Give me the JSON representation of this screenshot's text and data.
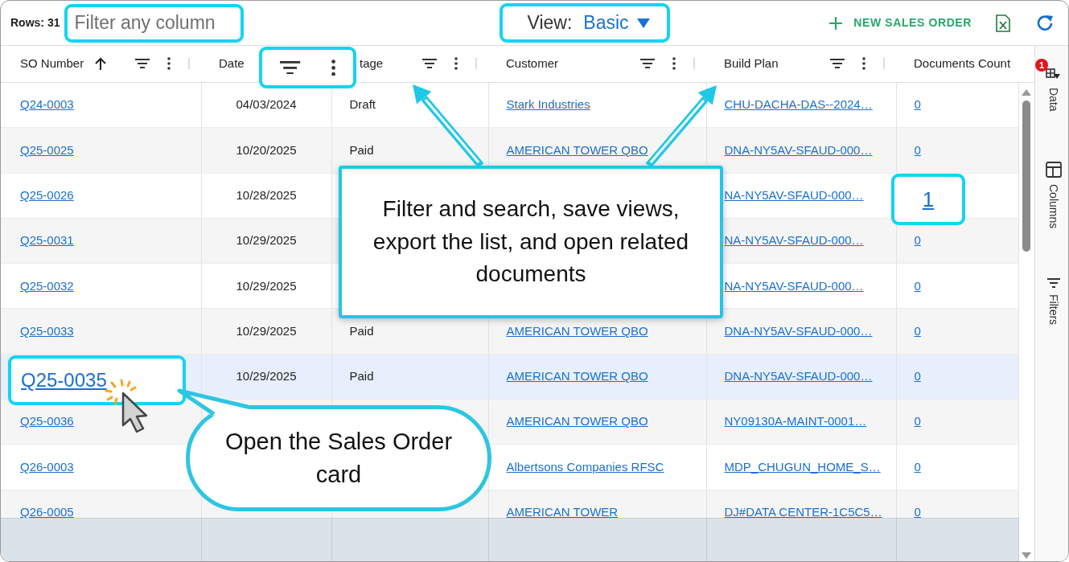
{
  "toolbar": {
    "rows_label": "Rows: 31",
    "filter": {
      "placeholder": "Filter any column"
    },
    "view": {
      "label": "View:",
      "value": "Basic"
    },
    "new_button": "NEW SALES ORDER"
  },
  "columns": [
    {
      "label": "SO Number",
      "kind": "link",
      "sorted": true,
      "has_menu": true,
      "zoomed": false
    },
    {
      "label": "Date",
      "kind": "date",
      "sorted": false,
      "has_menu": true,
      "zoomed": true
    },
    {
      "label": "tage",
      "kind": "text",
      "sorted": false,
      "has_menu": true,
      "zoomed": false
    },
    {
      "label": "Customer",
      "kind": "link",
      "sorted": false,
      "has_menu": true,
      "zoomed": false
    },
    {
      "label": "Build Plan",
      "kind": "link",
      "sorted": false,
      "has_menu": true,
      "zoomed": false
    },
    {
      "label": "Documents Count",
      "kind": "link",
      "sorted": false,
      "has_menu": false,
      "zoomed": false
    }
  ],
  "rows": [
    {
      "so_number": "Q24-0003",
      "date": "04/03/2024",
      "stage": "Draft",
      "customer": "Stark Industries",
      "build_plan": "CHU-DACHA-DAS--2024…",
      "documents": "0",
      "selected": false,
      "number_zoomed": false,
      "count_zoomed": false
    },
    {
      "so_number": "Q25-0025",
      "date": "10/20/2025",
      "stage": "Paid",
      "customer": "AMERICAN TOWER QBO",
      "build_plan": "DNA-NY5AV-SFAUD-000…",
      "documents": "0",
      "selected": false,
      "number_zoomed": false,
      "count_zoomed": false
    },
    {
      "so_number": "Q25-0026",
      "date": "10/28/2025",
      "build_plan": "NA-NY5AV-SFAUD-000…",
      "documents": "1",
      "selected": false,
      "number_zoomed": false,
      "count_zoomed": true
    },
    {
      "so_number": "Q25-0031",
      "date": "10/29/2025",
      "build_plan": "NA-NY5AV-SFAUD-000…",
      "documents": "0",
      "selected": false,
      "number_zoomed": false,
      "count_zoomed": false
    },
    {
      "so_number": "Q25-0032",
      "date": "10/29/2025",
      "build_plan": "NA-NY5AV-SFAUD-000…",
      "documents": "0",
      "selected": false,
      "number_zoomed": false,
      "count_zoomed": false
    },
    {
      "so_number": "Q25-0033",
      "date": "10/29/2025",
      "stage": "Paid",
      "customer": "AMERICAN TOWER QBO",
      "build_plan": "DNA-NY5AV-SFAUD-000…",
      "documents": "0",
      "selected": false,
      "number_zoomed": false,
      "count_zoomed": false
    },
    {
      "so_number": "Q25-0035",
      "date": "10/29/2025",
      "stage": "Paid",
      "customer": "AMERICAN TOWER QBO",
      "build_plan": "DNA-NY5AV-SFAUD-000…",
      "documents": "0",
      "selected": true,
      "number_zoomed": true,
      "count_zoomed": false
    },
    {
      "so_number": "Q25-0036",
      "customer": "AMERICAN TOWER QBO",
      "build_plan": "NY09130A-MAINT-0001…",
      "documents": "0",
      "selected": false,
      "number_zoomed": false,
      "count_zoomed": false
    },
    {
      "so_number": "Q26-0003",
      "customer": "Albertsons Companies RFSC",
      "build_plan": "MDP_CHUGUN_HOME_S…",
      "documents": "0",
      "selected": false,
      "number_zoomed": false,
      "count_zoomed": false
    },
    {
      "so_number": "Q26-0005",
      "customer": "AMERICAN TOWER",
      "build_plan": "DJ#DATA CENTER-1C5C5…",
      "documents": "0",
      "selected": false,
      "number_zoomed": false,
      "count_zoomed": false
    }
  ],
  "side_tabs": [
    {
      "label": "Data",
      "badge": "1"
    },
    {
      "label": "Columns"
    },
    {
      "label": "Filters"
    }
  ],
  "callouts": [
    {
      "kind": "box",
      "text": "Filter and search, save views, export the list, and open related documents"
    },
    {
      "kind": "bubble",
      "text": "Open the Sales Order card"
    }
  ]
}
